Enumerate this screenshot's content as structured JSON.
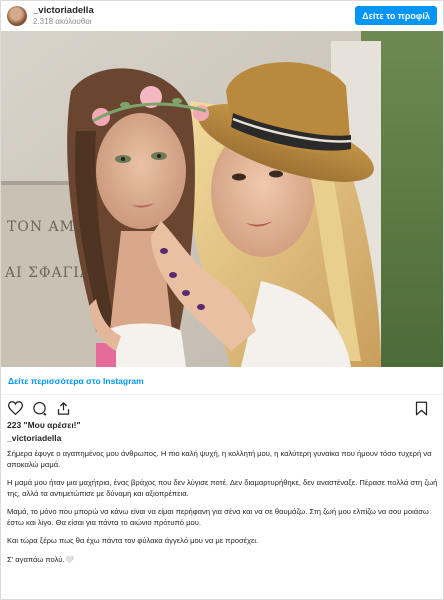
{
  "header": {
    "username": "_victoriadella",
    "followers": "2.318 ακόλουθοι",
    "profile_button": "Δείτε το προφίλ"
  },
  "photo": {
    "sign_line_1": "ΤΟΝ ΑΜΝΟ",
    "sign_line_2": "ΑΙ ΣΦΑΓΙΑΣΘ"
  },
  "instagram_link": "Δείτε περισσότερα στο Instagram",
  "actions": {
    "icons": [
      "heart-icon",
      "comment-icon",
      "share-icon",
      "bookmark-icon"
    ]
  },
  "likes": "223 \"Μου αρέσει!\"",
  "caption_username": "_victoriadella",
  "caption_paragraphs": [
    "Σήμερα έφυγε ο αγαπημένος μου άνθρωπος. Η πιο καλή ψυχή, η κολλητή μου, η καλύτερη γυναίκα που ήμουν τόσο τυχερή να αποκαλώ μαμά.",
    "Η μαμά μου ήταν μια μαχήτρια, ένας βράχος που δεν λύγισε ποτέ. Δεν διαμαρτυρήθηκε, δεν αναστέναξε. Πέρασε πολλά στη ζωή της, αλλά τα αντιμετώπισε με δύναμη και αξιοπρέπεια.",
    "Μαμά, το μόνο που μπορώ να κάνω είναι να είμαι περήφανη για σένα και να σε θαυμάζω. Στη ζωή μου ελπίζω να σου μοιάσω έστω και λίγο. Θα είσαι για πάντα το αιώνιο πρότυπό μου.",
    "Και τώρα ξέρω πως θα έχω πάντα τον φύλακα άγγελό μου να με προσέχει.",
    "Σ' αγαπάω πολύ.🤍"
  ],
  "colors": {
    "accent": "#0095f6",
    "text": "#262626",
    "muted": "#8e8e8e"
  }
}
